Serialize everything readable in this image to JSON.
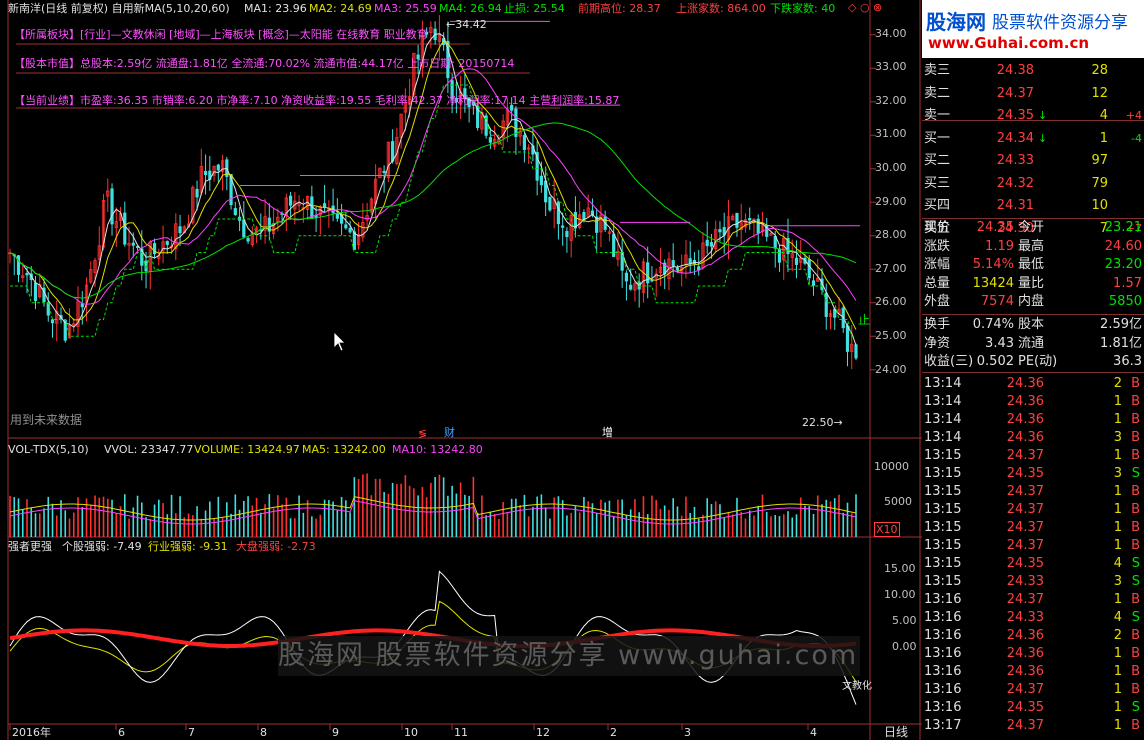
{
  "header": {
    "stock_title": "新南洋(日线 前复权) 自用新MA(5,10,20,60)",
    "ma1": "MA1: 23.96",
    "ma2": "MA2: 24.69",
    "ma3": "MA3: 25.59",
    "ma4": "MA4: 26.94",
    "stop": "止损: 25.54",
    "prev_high": "前期高位: 28.37",
    "up_count": "上涨家数: 864.00",
    "down_count": "下跌家数: 40",
    "colors": {
      "ma1": "#e0e0e0",
      "ma2": "#e0e000",
      "ma3": "#ff40ff",
      "ma4": "#00e000",
      "red": "#ff4040",
      "green": "#00e000"
    }
  },
  "info": {
    "line1": "【所属板块】[行业]—文教休闲 [地域]—上海板块 [概念]—太阳能 在线教育 职业教育",
    "line2": "【股本市值】总股本:2.59亿 流通盘:1.81亿 全流通:70.02% 流通市值:44.17亿 上市日期: 20150714",
    "line3": "【当前业绩】市盈率:36.35 市销率:6.20 市净率:7.10 净资收益率:19.55 毛利率:42.37 净利润率:17.14 主营利润率:15.87"
  },
  "price_axis": [
    "34.00",
    "33.00",
    "32.00",
    "31.00",
    "30.00",
    "29.00",
    "28.00",
    "27.00",
    "26.00",
    "25.00",
    "24.00"
  ],
  "annotations": {
    "high": "34.42",
    "low": "22.50",
    "future_data": "用到未来数据",
    "mark_cai": "财",
    "mark_zeng": "增",
    "mark_s": "≶",
    "stop_char": "止"
  },
  "volume": {
    "title": "VOL-TDX(5,10)",
    "vvol": "VVOL: 23347.77",
    "volume": "VOLUME: 13424.97",
    "ma5": "MA5: 13242.00",
    "ma10": "MA10: 13242.80",
    "axis": [
      "10000",
      "5000"
    ],
    "unit": "X10"
  },
  "strength": {
    "title": "强者更强",
    "stock": "个股强弱: -7.49",
    "industry": "行业强弱: -9.31",
    "market": "大盘强弱: -2.73",
    "axis": [
      "15.00",
      "10.00",
      "5.00",
      "0.00"
    ],
    "tail_label": "文教化"
  },
  "x_axis": [
    "2016年",
    "6",
    "7",
    "8",
    "9",
    "10",
    "11",
    "12",
    "2",
    "3",
    "4"
  ],
  "period": "日线",
  "watermark": "股海网 股票软件资源分享 www.guhai.com.cn",
  "brand": {
    "name": "股海网",
    "slogan": "股票软件资源分享",
    "url": "www.Guhai.com.cn"
  },
  "order_book": [
    {
      "label": "卖三",
      "price": "24.38",
      "vol": "28",
      "arrow": "",
      "chg": ""
    },
    {
      "label": "卖二",
      "price": "24.37",
      "vol": "12",
      "arrow": "",
      "chg": ""
    },
    {
      "label": "卖一",
      "price": "24.35",
      "vol": "4",
      "arrow": "↓",
      "chg": "+4"
    },
    {
      "label": "买一",
      "price": "24.34",
      "vol": "1",
      "arrow": "↓",
      "chg": "-4"
    },
    {
      "label": "买二",
      "price": "24.33",
      "vol": "97",
      "arrow": "",
      "chg": ""
    },
    {
      "label": "买三",
      "price": "24.32",
      "vol": "79",
      "arrow": "",
      "chg": ""
    },
    {
      "label": "买四",
      "price": "24.31",
      "vol": "10",
      "arrow": "",
      "chg": ""
    },
    {
      "label": "买五",
      "price": "24.30",
      "vol": "7",
      "arrow": "",
      "chg": "+7"
    }
  ],
  "quote": [
    {
      "k1": "现价",
      "v1": "24.35",
      "c1": "red",
      "k2": "今开",
      "v2": "23.21",
      "c2": "green"
    },
    {
      "k1": "涨跌",
      "v1": "1.19",
      "c1": "red",
      "k2": "最高",
      "v2": "24.60",
      "c2": "red"
    },
    {
      "k1": "涨幅",
      "v1": "5.14%",
      "c1": "red",
      "k2": "最低",
      "v2": "23.20",
      "c2": "green"
    },
    {
      "k1": "总量",
      "v1": "13424",
      "c1": "yellow",
      "k2": "量比",
      "v2": "1.57",
      "c2": "red"
    },
    {
      "k1": "外盘",
      "v1": "7574",
      "c1": "red",
      "k2": "内盘",
      "v2": "5850",
      "c2": "green"
    },
    {
      "k1": "换手",
      "v1": "0.74%",
      "c1": "white",
      "k2": "股本",
      "v2": "2.59亿",
      "c2": "white"
    },
    {
      "k1": "净资",
      "v1": "3.43",
      "c1": "white",
      "k2": "流通",
      "v2": "1.81亿",
      "c2": "white"
    },
    {
      "k1": "收益(三)",
      "v1": "0.502",
      "c1": "white",
      "k2": "PE(动)",
      "v2": "36.3",
      "c2": "white"
    }
  ],
  "ticks": [
    {
      "time": "13:14",
      "price": "24.36",
      "vol": "2",
      "side": "B"
    },
    {
      "time": "13:14",
      "price": "24.36",
      "vol": "1",
      "side": "B"
    },
    {
      "time": "13:14",
      "price": "24.36",
      "vol": "1",
      "side": "B"
    },
    {
      "time": "13:14",
      "price": "24.36",
      "vol": "3",
      "side": "B"
    },
    {
      "time": "13:15",
      "price": "24.37",
      "vol": "1",
      "side": "B"
    },
    {
      "time": "13:15",
      "price": "24.35",
      "vol": "3",
      "side": "S"
    },
    {
      "time": "13:15",
      "price": "24.37",
      "vol": "1",
      "side": "B"
    },
    {
      "time": "13:15",
      "price": "24.37",
      "vol": "1",
      "side": "B"
    },
    {
      "time": "13:15",
      "price": "24.37",
      "vol": "1",
      "side": "B"
    },
    {
      "time": "13:15",
      "price": "24.37",
      "vol": "1",
      "side": "B"
    },
    {
      "time": "13:15",
      "price": "24.35",
      "vol": "4",
      "side": "S"
    },
    {
      "time": "13:15",
      "price": "24.33",
      "vol": "3",
      "side": "S"
    },
    {
      "time": "13:16",
      "price": "24.37",
      "vol": "1",
      "side": "B"
    },
    {
      "time": "13:16",
      "price": "24.33",
      "vol": "4",
      "side": "S"
    },
    {
      "time": "13:16",
      "price": "24.36",
      "vol": "2",
      "side": "B"
    },
    {
      "time": "13:16",
      "price": "24.36",
      "vol": "1",
      "side": "B"
    },
    {
      "time": "13:16",
      "price": "24.36",
      "vol": "1",
      "side": "B"
    },
    {
      "time": "13:16",
      "price": "24.37",
      "vol": "1",
      "side": "B"
    },
    {
      "time": "13:16",
      "price": "24.35",
      "vol": "1",
      "side": "S"
    },
    {
      "time": "13:17",
      "price": "24.37",
      "vol": "1",
      "side": "B"
    }
  ],
  "chart_data": {
    "type": "line",
    "title": "新南洋(日线 前复权)",
    "ylim": [
      22.5,
      34.5
    ],
    "high": 34.42,
    "low": 22.5,
    "last": 24.35,
    "ma_last": {
      "MA1": 23.96,
      "MA2": 24.69,
      "MA3": 25.59,
      "MA4": 26.94
    },
    "close_path": [
      27.5,
      26.8,
      25.7,
      25.2,
      26.5,
      29.0,
      28.0,
      27.2,
      27.8,
      28.3,
      29.8,
      30.1,
      28.4,
      28.0,
      28.6,
      29.2,
      28.7,
      28.2,
      28.0,
      29.5,
      30.8,
      33.0,
      34.4,
      32.5,
      31.6,
      31.2,
      31.5,
      30.8,
      29.0,
      28.4,
      28.9,
      28.2,
      26.5,
      26.9,
      27.3,
      27.0,
      27.4,
      28.0,
      28.4,
      28.0,
      27.6,
      27.2,
      26.4,
      25.5,
      24.35
    ]
  }
}
